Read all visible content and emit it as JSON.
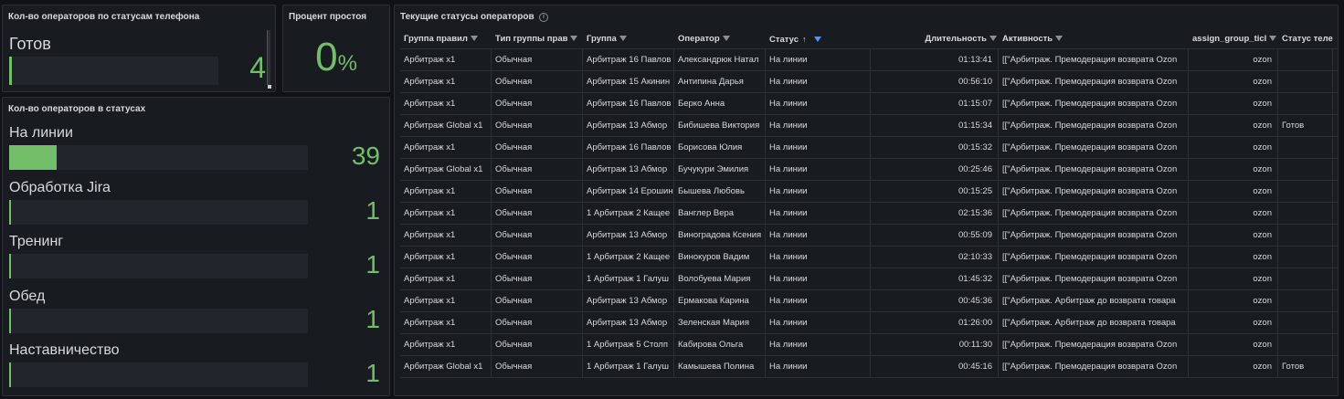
{
  "panel_phone_statuses": {
    "title": "Кол-во операторов по статусам телефона",
    "label": "Готов",
    "value": "4",
    "fill_fraction": 0.01
  },
  "panel_idle": {
    "title": "Процент простоя",
    "value": "0",
    "unit": "%"
  },
  "panel_statuses": {
    "title": "Кол-во операторов в статусах",
    "rows": [
      {
        "label": "На линии",
        "value": "39",
        "fill_fraction": 0.16
      },
      {
        "label": "Обработка Jira",
        "value": "1",
        "fill_fraction": 0.005
      },
      {
        "label": "Тренинг",
        "value": "1",
        "fill_fraction": 0.005
      },
      {
        "label": "Обед",
        "value": "1",
        "fill_fraction": 0.005
      },
      {
        "label": "Наставничество",
        "value": "1",
        "fill_fraction": 0.005
      }
    ]
  },
  "panel_table": {
    "title": "Текущие статусы операторов",
    "info_icon": "info-icon",
    "accent_color": "#5794f2",
    "columns": [
      "Группа правил",
      "Тип группы прав",
      "Группа",
      "Оператор",
      "Статус",
      "Длительность",
      "Активность",
      "assign_group_ticl",
      "Статус теле"
    ],
    "rows": [
      [
        "Арбитраж x1",
        "Обычная",
        "Арбитраж 16 Павлов",
        "Александрюк Натал",
        "На линии",
        "01:13:41",
        "[[\"Арбитраж. Премодерация возврата Ozon",
        "ozon",
        ""
      ],
      [
        "Арбитраж x1",
        "Обычная",
        "Арбитраж 15 Акинин",
        "Антипина Дарья",
        "На линии",
        "00:56:10",
        "[[\"Арбитраж. Премодерация возврата Ozon",
        "ozon",
        ""
      ],
      [
        "Арбитраж x1",
        "Обычная",
        "Арбитраж 16 Павлов",
        "Берко Анна",
        "На линии",
        "01:15:07",
        "[[\"Арбитраж. Премодерация возврата Ozon",
        "ozon",
        ""
      ],
      [
        "Арбитраж Global x1",
        "Обычная",
        "Арбитраж 13 Абмор",
        "Бибишева Виктория",
        "На линии",
        "01:15:34",
        "[[\"Арбитраж. Премодерация возврата Ozon",
        "ozon",
        "Готов"
      ],
      [
        "Арбитраж x1",
        "Обычная",
        "Арбитраж 16 Павлов",
        "Борисова Юлия",
        "На линии",
        "00:15:32",
        "[[\"Арбитраж. Премодерация возврата Ozon",
        "ozon",
        ""
      ],
      [
        "Арбитраж Global x1",
        "Обычная",
        "Арбитраж 13 Абмор",
        "Бучукури Эмилия",
        "На линии",
        "00:25:46",
        "[[\"Арбитраж. Премодерация возврата Ozon",
        "ozon",
        ""
      ],
      [
        "Арбитраж x1",
        "Обычная",
        "Арбитраж 14 Ерошин",
        "Бышева Любовь",
        "На линии",
        "00:15:25",
        "[[\"Арбитраж. Премодерация возврата Ozon",
        "ozon",
        ""
      ],
      [
        "Арбитраж x1",
        "Обычная",
        "1 Арбитраж 2 Кащее",
        "Ванглер Вера",
        "На линии",
        "02:15:36",
        "[[\"Арбитраж. Премодерация возврата Ozon",
        "ozon",
        ""
      ],
      [
        "Арбитраж x1",
        "Обычная",
        "Арбитраж 13 Абмор",
        "Виноградова Ксения",
        "На линии",
        "00:55:09",
        "[[\"Арбитраж. Премодерация возврата Ozon",
        "ozon",
        ""
      ],
      [
        "Арбитраж x1",
        "Обычная",
        "1 Арбитраж 2 Кащее",
        "Винокуров Вадим",
        "На линии",
        "02:10:33",
        "[[\"Арбитраж. Премодерация возврата Ozon",
        "ozon",
        ""
      ],
      [
        "Арбитраж x1",
        "Обычная",
        "1 Арбитраж 1 Галуш",
        "Волобуева Мария",
        "На линии",
        "01:45:32",
        "[[\"Арбитраж. Премодерация возврата Ozon",
        "ozon",
        ""
      ],
      [
        "Арбитраж x1",
        "Обычная",
        "Арбитраж 13 Абмор",
        "Ермакова Карина",
        "На линии",
        "00:45:36",
        "[[\"Арбитраж. Арбитраж до возврата товара",
        "ozon",
        ""
      ],
      [
        "Арбитраж x1",
        "Обычная",
        "Арбитраж 13 Абмор",
        "Зеленская Мария",
        "На линии",
        "01:26:00",
        "[[\"Арбитраж. Арбитраж до возврата товара",
        "ozon",
        ""
      ],
      [
        "Арбитраж x1",
        "Обычная",
        "1 Арбитраж 5 Столп",
        "Кабирова Ольга",
        "На линии",
        "00:11:30",
        "[[\"Арбитраж. Премодерация возврата Ozon",
        "ozon",
        ""
      ],
      [
        "Арбитраж Global x1",
        "Обычная",
        "1 Арбитраж 1 Галуш",
        "Камышева Полина",
        "На линии",
        "00:45:16",
        "[[\"Арбитраж. Премодерация возврата Ozon",
        "ozon",
        "Готов"
      ]
    ]
  }
}
